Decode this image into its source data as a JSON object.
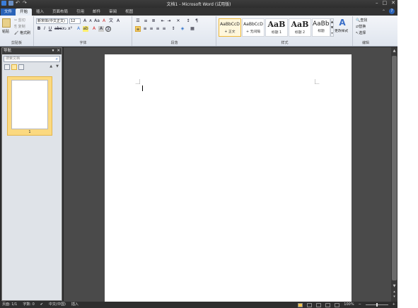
{
  "window": {
    "title": "文档1 - Microsoft Word (试用版)",
    "controls": [
      "–",
      "□",
      "✕"
    ]
  },
  "tabs": [
    "文件",
    "开始",
    "插入",
    "页面布局",
    "引用",
    "邮件",
    "审阅",
    "视图"
  ],
  "ribbon": {
    "clipboard": {
      "paste": "粘贴",
      "cut": "剪切",
      "copy": "复制",
      "format_painter": "格式刷",
      "label": "剪贴板"
    },
    "font": {
      "font_name": "新宋体(中文正文)",
      "font_size": "12",
      "label": "字体"
    },
    "paragraph": {
      "label": "段落"
    },
    "styles": {
      "items": [
        {
          "preview": "AaBbCcD",
          "name": "+ 正文"
        },
        {
          "preview": "AaBbCcD",
          "name": "+ 无间隔"
        },
        {
          "preview": "AaB",
          "name": "标题 1"
        },
        {
          "preview": "AaB",
          "name": "标题 2"
        },
        {
          "preview": "AaBbC",
          "name": "标题"
        }
      ],
      "change_styles": "更改样式",
      "label": "样式"
    },
    "editing": {
      "find": "查找",
      "replace": "替换",
      "select": "选择",
      "label": "编辑"
    }
  },
  "nav": {
    "title": "导航",
    "search_placeholder": "搜索文档",
    "page_number": "1"
  },
  "status": {
    "page": "页面: 1/1",
    "words": "字数: 0",
    "language": "中文(中国)",
    "mode": "插入",
    "zoom": "100%"
  }
}
